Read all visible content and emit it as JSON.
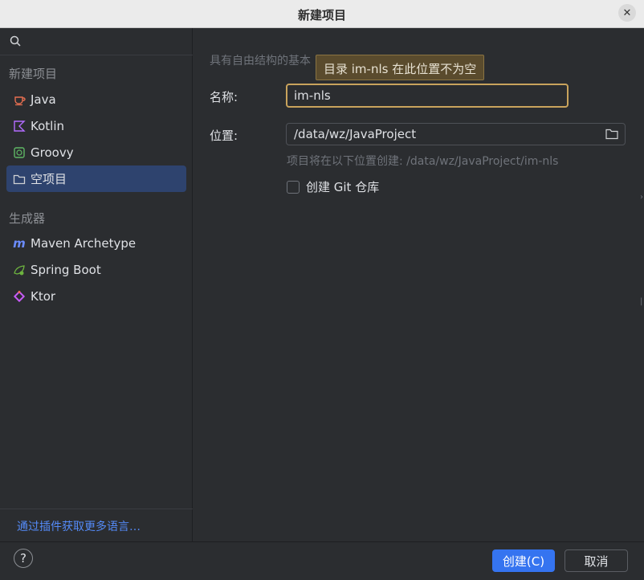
{
  "window": {
    "title": "新建项目",
    "close_icon": "close-icon"
  },
  "sidebar": {
    "search": {
      "placeholder": "",
      "icon": "search-icon"
    },
    "new_project_section": "新建项目",
    "items": [
      {
        "label": "Java",
        "icon": "java-icon",
        "color": "#e76f51"
      },
      {
        "label": "Kotlin",
        "icon": "kotlin-icon",
        "color": "#b36cff"
      },
      {
        "label": "Groovy",
        "icon": "groovy-icon",
        "color": "#5fb865"
      },
      {
        "label": "空项目",
        "icon": "empty-project-icon",
        "color": "#cfd1d4"
      }
    ],
    "generators_section": "生成器",
    "generators": [
      {
        "label": "Maven Archetype",
        "icon": "maven-icon",
        "color": "#6b8cff"
      },
      {
        "label": "Spring Boot",
        "icon": "spring-boot-icon",
        "color": "#6db33f"
      },
      {
        "label": "Ktor",
        "icon": "ktor-icon",
        "color": "#c65bf7"
      }
    ],
    "plugins_link": "通过插件获取更多语言…"
  },
  "main": {
    "description": "具有自由结构的基本",
    "tooltip": "目录 im-nls 在此位置不为空",
    "name_label": "名称:",
    "name_value": "im-nls",
    "location_label": "位置:",
    "location_value": "/data/wz/JavaProject",
    "location_hint": "项目将在以下位置创建: /data/wz/JavaProject/im-nls",
    "git_checkbox_label": "创建 Git 仓库",
    "git_checked": false
  },
  "footer": {
    "help_label": "?",
    "create_button": "创建(C)",
    "cancel_button": "取消"
  },
  "colors": {
    "accent": "#3574f0",
    "selection": "#2e436e",
    "warning_border": "#c9a35c",
    "link": "#548af7"
  }
}
